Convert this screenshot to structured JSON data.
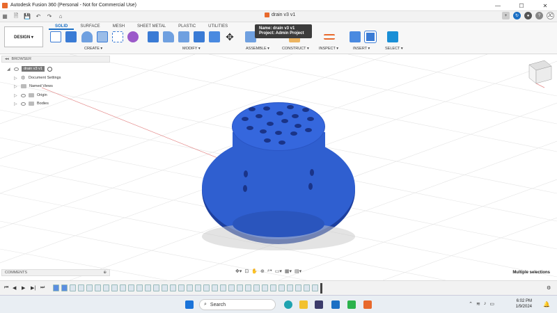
{
  "window": {
    "title": "Autodesk Fusion 360 (Personal - Not for Commercial Use)",
    "controls": [
      "—",
      "☐",
      "✕"
    ]
  },
  "document": {
    "tab_label": "drain v3 v1",
    "user_initials": "JC"
  },
  "toolbar": {
    "design_label": "DESIGN ▾",
    "tabs": [
      "SOLID",
      "SURFACE",
      "MESH",
      "SHEET METAL",
      "PLASTIC",
      "UTILITIES"
    ],
    "groups": [
      "CREATE ▾",
      "MODIFY ▾",
      "ASSEMBLE ▾",
      "CONSTRUCT ▾",
      "INSPECT ▾",
      "INSERT ▾",
      "SELECT ▾"
    ]
  },
  "tooltip": {
    "name_line": "Name: drain v3 v1",
    "project_line": "Project: Admin Project"
  },
  "browser": {
    "header": "BROWSER",
    "root": "drain v3 v1",
    "items": [
      "Document Settings",
      "Named Views",
      "Origin",
      "Bodies"
    ]
  },
  "comments": {
    "header": "COMMENTS"
  },
  "status": {
    "selection": "Multiple selections"
  },
  "taskbar": {
    "search_placeholder": "Search",
    "time": "6:02 PM",
    "date": "1/9/2024"
  },
  "colors": {
    "accent": "#1a6fc4",
    "model_blue": "#2f5fd0",
    "app_orange": "#e8692c"
  }
}
